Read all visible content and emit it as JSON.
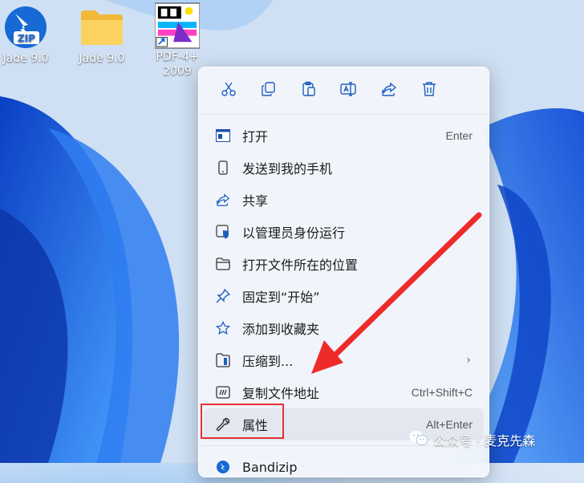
{
  "desktop": {
    "icons": [
      {
        "label": "Jade 9.0",
        "badge": "ZIP",
        "icon": "zip-archive-icon"
      },
      {
        "label": "Jade 9.0",
        "icon": "folder-icon"
      },
      {
        "label": "PDF-4+ 2009",
        "icon": "app-shortcut-icon"
      }
    ]
  },
  "context_menu": {
    "toolbar": [
      "cut-icon",
      "copy-icon",
      "paste-icon",
      "rename-icon",
      "share-icon",
      "delete-icon"
    ],
    "items": [
      {
        "label": "打开",
        "shortcut": "Enter",
        "icon": "open-icon"
      },
      {
        "label": "发送到我的手机",
        "icon": "phone-icon"
      },
      {
        "label": "共享",
        "icon": "share-icon"
      },
      {
        "label": "以管理员身份运行",
        "icon": "admin-shield-icon"
      },
      {
        "label": "打开文件所在的位置",
        "icon": "folder-open-icon"
      },
      {
        "label": "固定到“开始”",
        "icon": "pin-icon"
      },
      {
        "label": "添加到收藏夹",
        "icon": "star-icon"
      },
      {
        "label": "压缩到...",
        "icon": "compress-icon",
        "submenu": "›"
      },
      {
        "label": "复制文件地址",
        "shortcut": "Ctrl+Shift+C",
        "icon": "copy-path-icon"
      },
      {
        "label": "属性",
        "shortcut": "Alt+Enter",
        "icon": "wrench-icon"
      },
      {
        "label": "Bandizip",
        "icon": "bandizip-icon"
      }
    ]
  },
  "watermark": {
    "text": "公众号 · 麦克先森"
  },
  "colors": {
    "highlight": "#e53030",
    "accent": "#1f5fe0"
  }
}
